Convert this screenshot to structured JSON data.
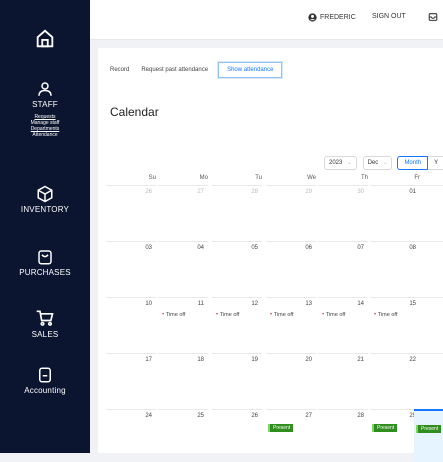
{
  "sidebar": {
    "items": [
      {
        "label": "STAFF",
        "icon": "person-icon"
      },
      {
        "label": "INVENTORY",
        "icon": "cube-icon"
      },
      {
        "label": "PURCHASES",
        "icon": "bag-icon"
      },
      {
        "label": "SALES",
        "icon": "cart-icon"
      },
      {
        "label": "Accounting",
        "icon": "document-icon"
      }
    ],
    "staff_links": [
      "Requests",
      "Manage staff",
      "Departments",
      "Attendance"
    ]
  },
  "header": {
    "user_name": "FREDERIC",
    "sign_out": "SIGN OUT"
  },
  "tabs": [
    "Record",
    "Request past attendance",
    "Show attendance"
  ],
  "active_tab": 2,
  "calendar": {
    "title": "Calendar",
    "year": "2023",
    "month": "Dec",
    "mode_month": "Month",
    "mode_year": "Y",
    "weekdays": [
      "Su",
      "Mo",
      "Tu",
      "We",
      "Th",
      "Fr"
    ],
    "weeks": [
      [
        {
          "d": "26",
          "m": true
        },
        {
          "d": "27",
          "m": true
        },
        {
          "d": "28",
          "m": true
        },
        {
          "d": "29",
          "m": true
        },
        {
          "d": "30",
          "m": true
        },
        {
          "d": "01"
        }
      ],
      [
        {
          "d": "03"
        },
        {
          "d": "04"
        },
        {
          "d": "05"
        },
        {
          "d": "06"
        },
        {
          "d": "07"
        },
        {
          "d": "08"
        }
      ],
      [
        {
          "d": "10"
        },
        {
          "d": "11",
          "ev": "Time off"
        },
        {
          "d": "12",
          "ev": "Time off"
        },
        {
          "d": "13",
          "ev": "Time off"
        },
        {
          "d": "14",
          "ev": "Time off"
        },
        {
          "d": "15",
          "ev": "Time off"
        }
      ],
      [
        {
          "d": "17"
        },
        {
          "d": "18"
        },
        {
          "d": "19"
        },
        {
          "d": "20"
        },
        {
          "d": "21"
        },
        {
          "d": "22"
        }
      ],
      [
        {
          "d": "24"
        },
        {
          "d": "25"
        },
        {
          "d": "26"
        },
        {
          "d": "27",
          "badge": "Present"
        },
        {
          "d": "28"
        },
        {
          "d": "29",
          "badge": "Present"
        }
      ]
    ],
    "extra_today_badge": "Present"
  },
  "colors": {
    "sidebar": "#0c1530",
    "accent": "#1677ff",
    "timeoff_dot": "#e5484d",
    "present": "#2f8e1e"
  }
}
